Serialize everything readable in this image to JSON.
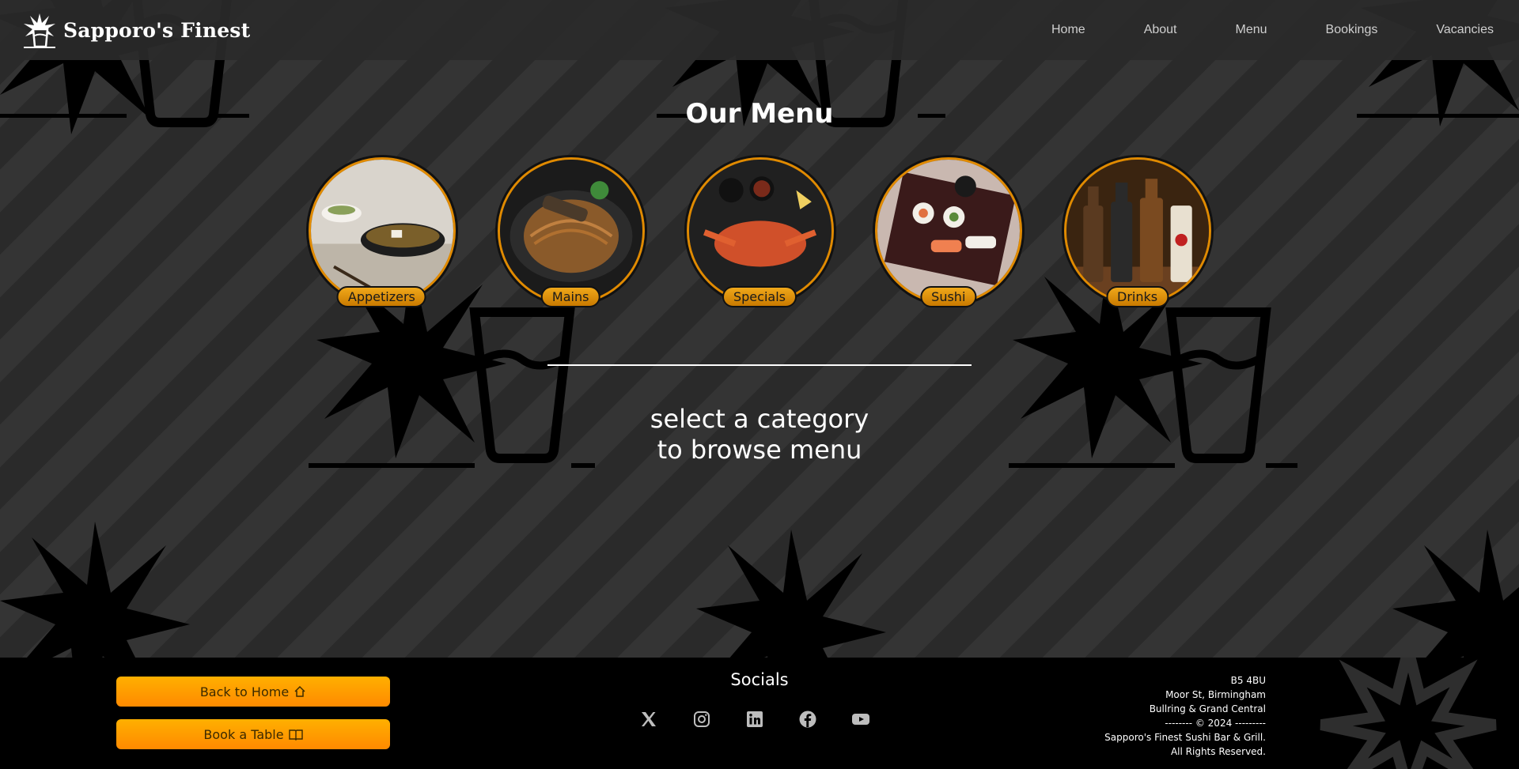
{
  "brand": {
    "name": "Sapporo's Finest",
    "logo_icon": "sun-glass-logo-icon"
  },
  "nav": {
    "items": [
      {
        "label": "Home"
      },
      {
        "label": "About"
      },
      {
        "label": "Menu"
      },
      {
        "label": "Bookings"
      },
      {
        "label": "Vacancies"
      }
    ]
  },
  "main": {
    "title": "Our Menu",
    "categories": [
      {
        "label": "Appetizers",
        "image": "miso-soup-bowl"
      },
      {
        "label": "Mains",
        "image": "noodles-with-fish"
      },
      {
        "label": "Specials",
        "image": "crab-platter"
      },
      {
        "label": "Sushi",
        "image": "sushi-tray"
      },
      {
        "label": "Drinks",
        "image": "sake-bottles"
      }
    ],
    "prompt_line1": "select a category",
    "prompt_line2": "to browse menu"
  },
  "footer": {
    "back_home_label": "Back to Home",
    "book_table_label": "Book a Table",
    "socials_title": "Socials",
    "socials": [
      {
        "icon": "x-twitter-icon"
      },
      {
        "icon": "instagram-icon"
      },
      {
        "icon": "linkedin-icon"
      },
      {
        "icon": "facebook-icon"
      },
      {
        "icon": "youtube-icon"
      }
    ],
    "address": {
      "line1": "B5 4BU",
      "line2": "Moor St, Birmingham",
      "line3": "Bullring & Grand Central",
      "line4": "-------- © 2024 ---------",
      "line5": "Sapporo's Finest Sushi Bar & Grill.",
      "line6": "All Rights Reserved."
    }
  },
  "colors": {
    "accent": "#ff9a00",
    "accent_dark": "#c97a00",
    "header_bg": "#2a2a2a",
    "footer_bg": "#000000"
  }
}
